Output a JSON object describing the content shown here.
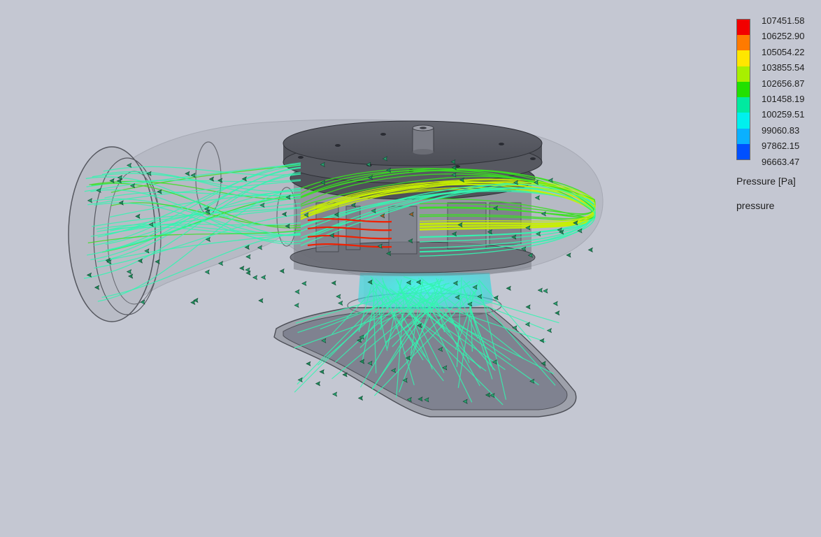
{
  "legend": {
    "title": "Pressure [Pa]",
    "subtitle": "pressure",
    "values": [
      "107451.58",
      "106252.90",
      "105054.22",
      "103855.54",
      "102656.87",
      "101458.19",
      "100259.51",
      "99060.83",
      "97862.15",
      "96663.47"
    ],
    "colors": [
      "#f20000",
      "#ff7a00",
      "#ffe600",
      "#a8ef00",
      "#22e000",
      "#00eaa0",
      "#00f0ee",
      "#0ab0ff",
      "#0050ff",
      "#0010f0"
    ]
  },
  "colors": {
    "background": "#c4c7d2",
    "housing": "#5c5e66",
    "housing_light": "#8e9099",
    "shell": "#adb0bb",
    "streamline_low": "#33f5b0",
    "streamline_mid": "#3ae020",
    "streamline_high": "#f02000"
  }
}
